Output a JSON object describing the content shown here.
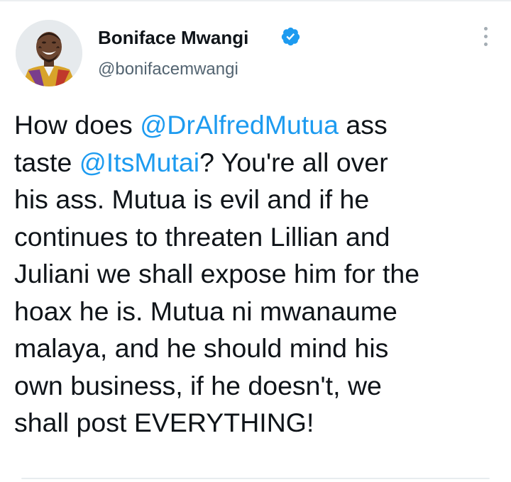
{
  "author": {
    "name": "Boniface Mwangi",
    "handle": "@bonifacemwangi",
    "verified": true,
    "verified_color": "#1d9bf0"
  },
  "menu_icon": "more-vertical-icon",
  "tweet": {
    "l1": {
      "a": "How does ",
      "m": "@DrAlfredMutua",
      "b": " ass"
    },
    "l2": {
      "a": "taste ",
      "m": "@ItsMutai",
      "b": "? You're all over"
    },
    "l3": "his ass. Mutua is evil and if he",
    "l4": "continues to threaten Lillian and",
    "l5": "Juliani we shall expose him for the",
    "l6": "hoax he is. Mutua ni mwanaume",
    "l7": "malaya, and he should mind his",
    "l8": "own business, if he doesn't, we",
    "l9": "shall post EVERYTHING!"
  },
  "colors": {
    "text": "#0f1419",
    "secondary": "#536471",
    "link": "#1d9bf0"
  }
}
